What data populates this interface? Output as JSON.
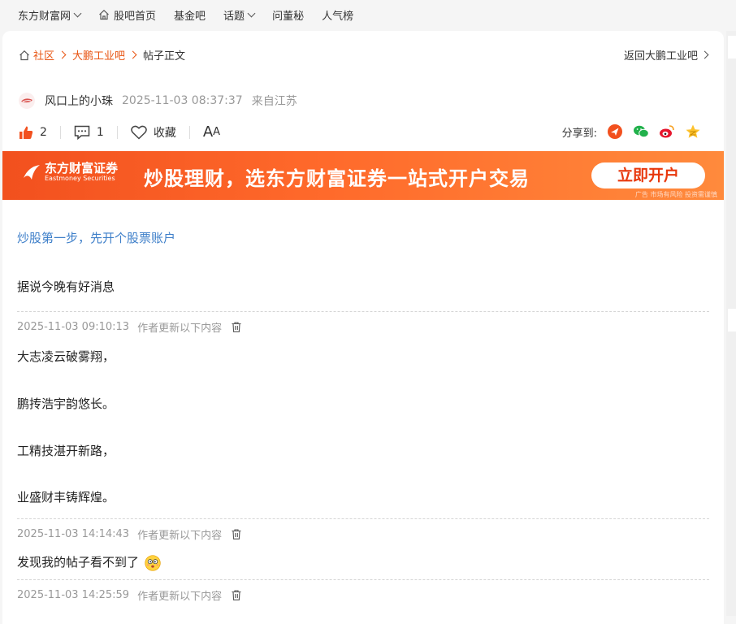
{
  "topnav": {
    "items": [
      {
        "label": "东方财富网",
        "dropdown": true
      },
      {
        "label": "股吧首页",
        "icon": "home-icon"
      },
      {
        "label": "基金吧"
      },
      {
        "label": "话题",
        "dropdown": true
      },
      {
        "label": "问董秘"
      },
      {
        "label": "人气榜"
      }
    ]
  },
  "breadcrumb": {
    "items": [
      "社区",
      "大鹏工业吧",
      "帖子正文"
    ],
    "back": "返回大鹏工业吧"
  },
  "post": {
    "author": "风口上的小珠",
    "time": "2025-11-03 08:37:37",
    "location": "来自江苏",
    "likes": "2",
    "comments": "1",
    "favorite": "收藏",
    "font_icon_big": "A",
    "font_icon_small": "A",
    "share_label": "分享到:"
  },
  "banner": {
    "logo_cn": "东方财富证券",
    "logo_en": "Eastmoney Securities",
    "slogan": "炒股理财，选东方财富证券一站式开户交易",
    "cta": "立即开户",
    "disclaimer": "广告 市场有风险 投资需谨慎"
  },
  "promo_link": "炒股第一步，先开个股票账户",
  "body": {
    "original": "据说今晚有好消息",
    "updates": [
      {
        "time": "2025-11-03 09:10:13",
        "hint": "作者更新以下内容",
        "lines": [
          "大志凌云破雾翔，",
          "鹏抟浩宇韵悠长。",
          "工精技湛开新路，",
          "业盛财丰铸辉煌。"
        ]
      },
      {
        "time": "2025-11-03 14:14:43",
        "hint": "作者更新以下内容",
        "lines": [
          "发现我的帖子看不到了"
        ]
      },
      {
        "time": "2025-11-03 14:25:59",
        "hint": "作者更新以下内容",
        "lines": []
      }
    ]
  },
  "colors": {
    "accent": "#e85412",
    "link": "#3e7fc9",
    "banner": "#ff6a2b"
  }
}
